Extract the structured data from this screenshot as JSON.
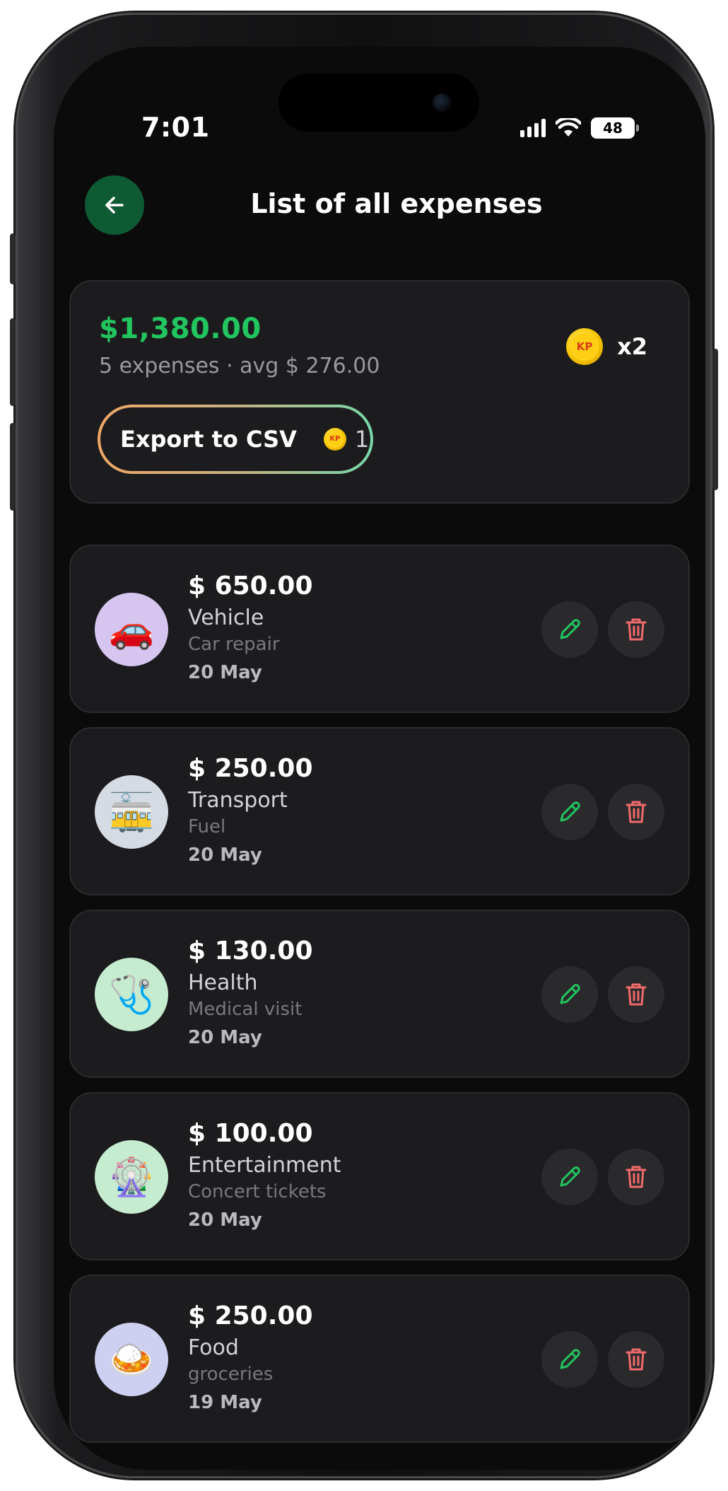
{
  "status_bar": {
    "time": "7:01",
    "battery": "48"
  },
  "header": {
    "title": "List of all expenses"
  },
  "summary": {
    "total": "$1,380.00",
    "subline": "5 expenses · avg $ 276.00",
    "multiplier": "x2",
    "coin_label": "KP",
    "export_label": "Export to CSV",
    "export_cost": "1"
  },
  "expenses": [
    {
      "amount": "$ 650.00",
      "category": "Vehicle",
      "note": "Car repair",
      "date": "20 May",
      "icon": "car-repair-icon",
      "icon_bg": "#d6c5ef"
    },
    {
      "amount": "$ 250.00",
      "category": "Transport",
      "note": "Fuel",
      "date": "20 May",
      "icon": "tram-icon",
      "icon_bg": "#d5dbe2"
    },
    {
      "amount": "$ 130.00",
      "category": "Health",
      "note": "Medical visit",
      "date": "20 May",
      "icon": "doctor-icon",
      "icon_bg": "#c6ecd0"
    },
    {
      "amount": "$ 100.00",
      "category": "Entertainment",
      "note": "Concert tickets",
      "date": "20 May",
      "icon": "amusement-park-icon",
      "icon_bg": "#c6ecd0"
    },
    {
      "amount": "$ 250.00",
      "category": "Food",
      "note": "groceries",
      "date": "19 May",
      "icon": "food-plate-icon",
      "icon_bg": "#cdd0f0"
    }
  ],
  "colors": {
    "accent_green": "#22c55e",
    "delete_red": "#f06a6a",
    "back_button": "#0e5a33"
  }
}
